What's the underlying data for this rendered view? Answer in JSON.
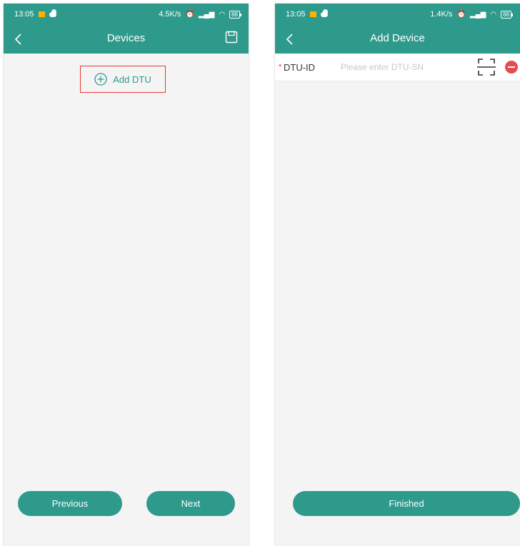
{
  "left_screen": {
    "status": {
      "time": "13:05",
      "speed": "4.5K/s",
      "battery": "88"
    },
    "title": "Devices",
    "add_button_label": "Add DTU",
    "previous_label": "Previous",
    "next_label": "Next"
  },
  "right_screen": {
    "status": {
      "time": "13:05",
      "speed": "1.4K/s",
      "battery": "88"
    },
    "title": "Add Device",
    "field": {
      "required_mark": "*",
      "label": "DTU-ID",
      "placeholder": "Please enter DTU-SN",
      "value": ""
    },
    "finish_label": "Finished"
  },
  "colors": {
    "accent": "#2e9a8c",
    "highlight_border": "#e53935",
    "remove": "#e74c4c",
    "background": "#f4f4f4"
  },
  "icons": [
    "back-icon",
    "save-icon",
    "plus-circle-icon",
    "scan-icon",
    "remove-icon",
    "alarm-icon",
    "signal-icon",
    "wifi-icon",
    "battery-icon"
  ]
}
